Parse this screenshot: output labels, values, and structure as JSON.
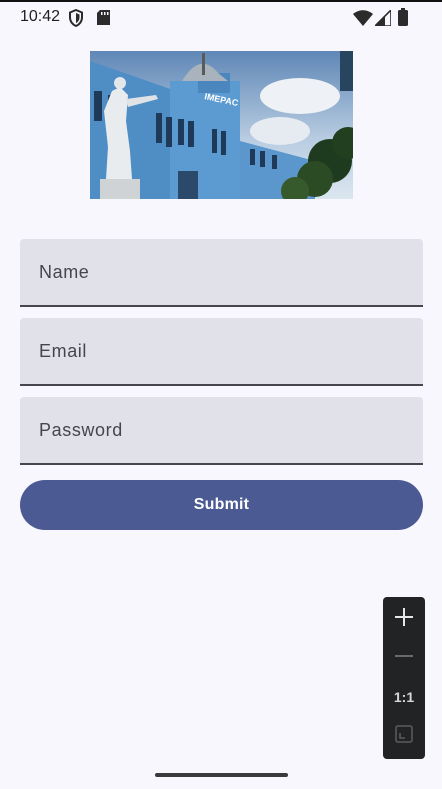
{
  "status_bar": {
    "time": "10:42",
    "icons": [
      "shield-icon",
      "sd-card-icon",
      "wifi-icon",
      "signal-icon",
      "battery-icon"
    ]
  },
  "hero_image": {
    "sign_text": "IMEPAC",
    "description_icon": "building-photo"
  },
  "form": {
    "name_label": "Name",
    "email_label": "Email",
    "password_label": "Password",
    "submit_label": "Submit"
  },
  "zoom_controls": {
    "zoom_in_icon": "plus-icon",
    "zoom_out_icon": "minus-icon",
    "reset_label": "1:1",
    "fit_icon": "fit-screen-icon"
  },
  "colors": {
    "background": "#f8f7fd",
    "field_bg": "#e1e1ea",
    "primary": "#4b5a92",
    "zoom_panel": "#222325"
  }
}
